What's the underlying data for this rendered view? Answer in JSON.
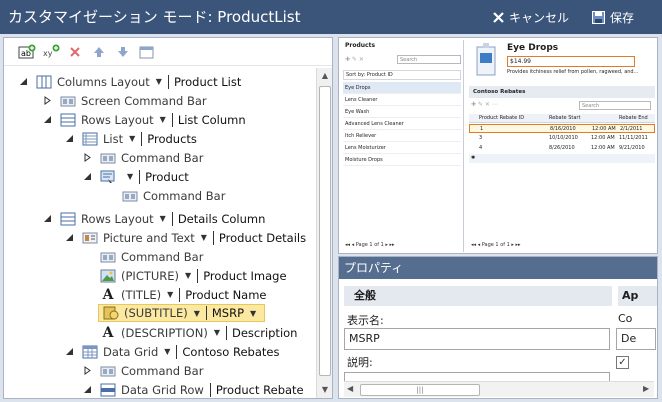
{
  "window": {
    "title": "カスタマイゼーション モード: ProductList",
    "cancel_label": "キャンセル",
    "save_label": "保存"
  },
  "tree": [
    {
      "label": "Columns Layout",
      "value": "Product List",
      "dropdown": true
    },
    {
      "label": "Screen Command Bar",
      "value": "",
      "dropdown": false
    },
    {
      "label": "Rows Layout",
      "value": "List Column",
      "dropdown": true
    },
    {
      "label": "List",
      "value": "Products",
      "dropdown": true
    },
    {
      "label": "Command Bar",
      "value": "",
      "dropdown": false
    },
    {
      "label": "",
      "value": "Product",
      "dropdown": true
    },
    {
      "label": "Command Bar",
      "value": "",
      "dropdown": false
    },
    {
      "label": "Rows Layout",
      "value": "Details Column",
      "dropdown": true
    },
    {
      "label": "Picture and Text",
      "value": "Product Details",
      "dropdown": true
    },
    {
      "label": "Command Bar",
      "value": "",
      "dropdown": false
    },
    {
      "label": "(PICTURE)",
      "value": "Product Image",
      "dropdown": true
    },
    {
      "label": "(TITLE)",
      "value": "Product Name",
      "dropdown": true
    },
    {
      "label": "(SUBTITLE)",
      "value": "MSRP",
      "dropdown": true
    },
    {
      "label": "(DESCRIPTION)",
      "value": "Description",
      "dropdown": true
    },
    {
      "label": "Data Grid",
      "value": "Contoso Rebates",
      "dropdown": true
    },
    {
      "label": "Command Bar",
      "value": "",
      "dropdown": false
    },
    {
      "label": "Data Grid Row",
      "value": "Product Rebate",
      "dropdown": false
    }
  ],
  "preview": {
    "list_title": "Products",
    "search_placeholder": "Search",
    "sort_label": "Sort by: Product ID",
    "items": [
      "Eye Drops",
      "Lens Cleaner",
      "Eye Wash",
      "Advanced Lens Cleaner",
      "Itch Reliever",
      "Lens Moisturizer",
      "Moisture Drops"
    ],
    "pager_page": "Page",
    "pager_num": "1",
    "pager_of": "of 1",
    "detail_title": "Eye Drops",
    "detail_msrp": "$14.99",
    "detail_desc": "Provides itchiness relief from pollen, ragweed, and...",
    "rebates_title": "Contoso Rebates",
    "rebates_search": "Search",
    "grid_headers": [
      "Product Rebate ID",
      "Rebate Start",
      "Rebate End"
    ],
    "grid_rows": [
      [
        "1",
        "8/16/2010",
        "12:00 AM",
        "2/1/2011"
      ],
      [
        "3",
        "10/10/2010",
        "12:00 AM",
        "11/11/2011"
      ],
      [
        "4",
        "8/26/2010",
        "12:00 AM",
        "9/21/2010"
      ]
    ]
  },
  "properties": {
    "title": "プロパティ",
    "section_general": "全般",
    "section_ap": "Ap",
    "display_name_label": "表示名:",
    "display_name_value": "MSRP",
    "description_label": "説明:",
    "co_label": "Co",
    "de_value": "De",
    "checkbox_mark": "✓"
  },
  "colors": {
    "titlebar": "#3b5479",
    "properties_header": "#556d8f",
    "highlight": "#fbe9a1",
    "msrp_border": "#e07b27"
  }
}
